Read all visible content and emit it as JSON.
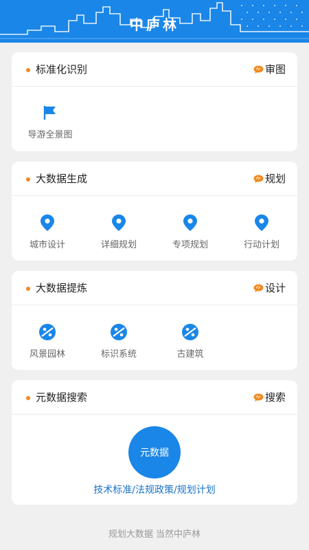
{
  "header": {
    "title": "中庐林"
  },
  "sections": [
    {
      "title": "标准化识别",
      "action_label": "审图",
      "items": [
        {
          "label": "导游全景图",
          "icon": "flag-icon"
        }
      ]
    },
    {
      "title": "大数据生成",
      "action_label": "规划",
      "items": [
        {
          "label": "城市设计",
          "icon": "location-pin-icon"
        },
        {
          "label": "详细规划",
          "icon": "location-pin-icon"
        },
        {
          "label": "专项规划",
          "icon": "location-pin-icon"
        },
        {
          "label": "行动计划",
          "icon": "location-pin-icon"
        }
      ]
    },
    {
      "title": "大数据提炼",
      "action_label": "设计",
      "items": [
        {
          "label": "风景园林",
          "icon": "compass-icon"
        },
        {
          "label": "标识系统",
          "icon": "compass-icon"
        },
        {
          "label": "古建筑",
          "icon": "compass-icon"
        }
      ]
    },
    {
      "title": "元数据搜索",
      "action_label": "搜索",
      "button_label": "元数据",
      "links_text": "技术标准/法规政策/规划计划"
    }
  ],
  "footer": {
    "slogan": "规划大数据 当然中庐林"
  },
  "colors": {
    "primary": "#1a86e8",
    "accent": "#f08a1f",
    "background": "#f0f0f0"
  }
}
